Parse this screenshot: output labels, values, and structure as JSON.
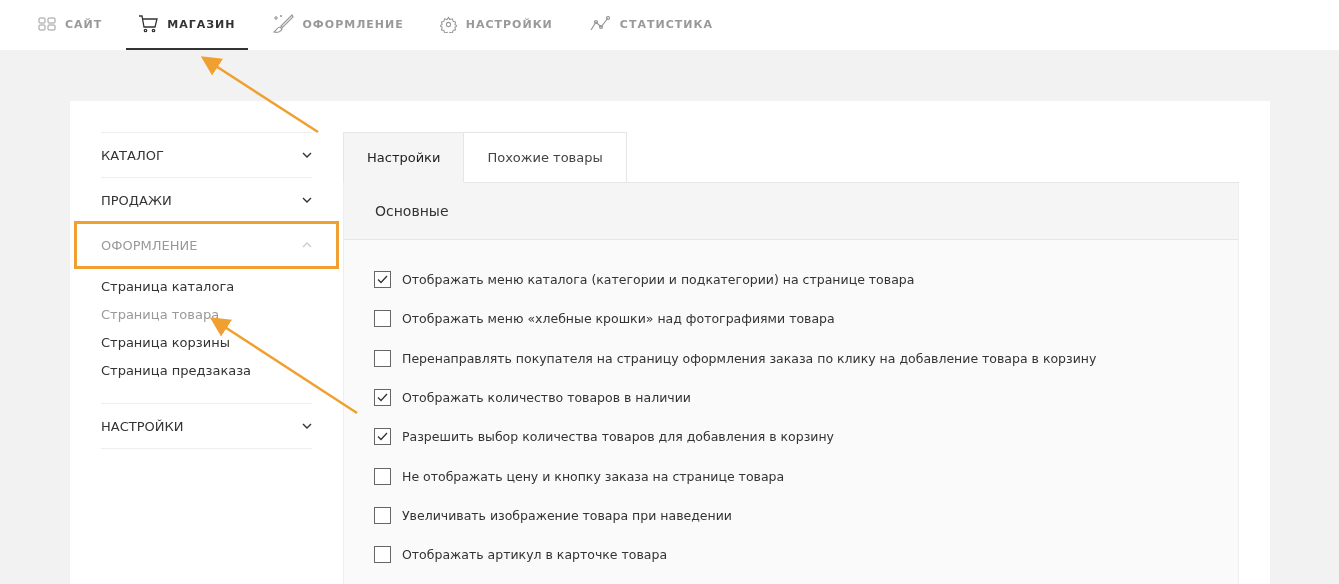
{
  "nav": [
    {
      "label": "САЙТ",
      "selected": false
    },
    {
      "label": "МАГАЗИН",
      "selected": true
    },
    {
      "label": "ОФОРМЛЕНИЕ",
      "selected": false
    },
    {
      "label": "НАСТРОЙКИ",
      "selected": false
    },
    {
      "label": "СТАТИСТИКА",
      "selected": false
    }
  ],
  "sidebar": [
    {
      "label": "КАТАЛОГ",
      "expanded": false,
      "highlighted": false
    },
    {
      "label": "ПРОДАЖИ",
      "expanded": false,
      "highlighted": false
    },
    {
      "label": "ОФОРМЛЕНИЕ",
      "expanded": true,
      "highlighted": true,
      "children": [
        {
          "label": "Страница каталога",
          "selected": false
        },
        {
          "label": "Страница товара",
          "selected": true
        },
        {
          "label": "Страница корзины",
          "selected": false
        },
        {
          "label": "Страница предзаказа",
          "selected": false
        }
      ]
    },
    {
      "label": "НАСТРОЙКИ",
      "expanded": false,
      "highlighted": false
    }
  ],
  "tabs": [
    {
      "label": "Настройки",
      "selected": true
    },
    {
      "label": "Похожие товары",
      "selected": false
    }
  ],
  "panel": {
    "title": "Основные",
    "options": [
      {
        "label": "Отображать меню каталога (категории и подкатегории) на странице товара",
        "checked": true
      },
      {
        "label": "Отображать меню «хлебные крошки» над фотографиями товара",
        "checked": false
      },
      {
        "label": "Перенаправлять покупателя на страницу оформления заказа по клику на добавление товара в корзину",
        "checked": false
      },
      {
        "label": "Отображать количество товаров в наличии",
        "checked": true
      },
      {
        "label": "Разрешить выбор количества товаров для добавления в корзину",
        "checked": true
      },
      {
        "label": "Не отображать цену и кнопку заказа на странице товара",
        "checked": false
      },
      {
        "label": "Увеличивать изображение товара при наведении",
        "checked": false
      },
      {
        "label": "Отображать артикул в карточке товара",
        "checked": false
      }
    ]
  }
}
